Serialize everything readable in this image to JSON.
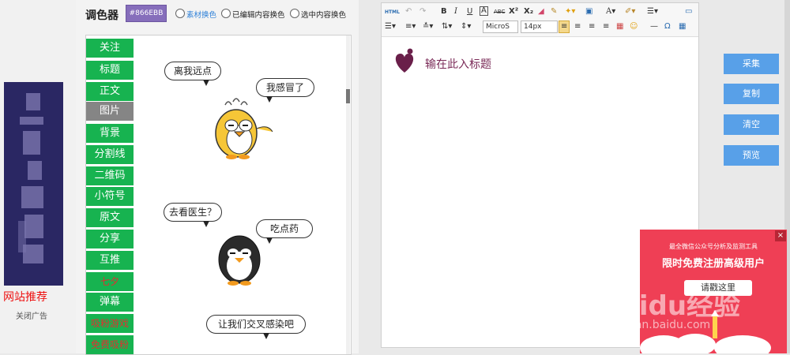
{
  "colors": {
    "swatch": "#866EBB",
    "menu_green": "#17b350",
    "menu_active": "#858585",
    "button_blue": "#58a0e8",
    "popup_red": "#ef3f55"
  },
  "left_ad": {
    "title": "网站推荐",
    "close": "关闭广告"
  },
  "picker": {
    "label": "调色器",
    "swatch_value": "#866EBB",
    "options": [
      "素材换色",
      "已编辑内容换色",
      "选中内容换色"
    ]
  },
  "menu": [
    "关注",
    "标题",
    "正文",
    "图片",
    "背景",
    "分割线",
    "二维码",
    "小符号",
    "原文",
    "分享",
    "互推",
    "七夕",
    "弹幕",
    "吸粉游戏",
    "免费吸粉"
  ],
  "menu_active_index": 3,
  "comic": {
    "bubbles": [
      "离我远点",
      "我感冒了",
      "去看医生？",
      "吃点药",
      "让我们交叉感染吧"
    ]
  },
  "toolbar": {
    "font_family": "MicroS",
    "font_size": "14px",
    "html_label": "HTML"
  },
  "editor": {
    "placeholder_title": "输在此入标题"
  },
  "right_buttons": [
    "采集",
    "复制",
    "清空",
    "预览"
  ],
  "popup": {
    "subtitle": "最全微信公众号分析及监测工具",
    "headline": "限时免费注册高级用户",
    "cta": "请戳这里",
    "close": "×"
  },
  "watermark": {
    "main": "Baidu经验",
    "sub": "jingyan.baidu.com"
  }
}
